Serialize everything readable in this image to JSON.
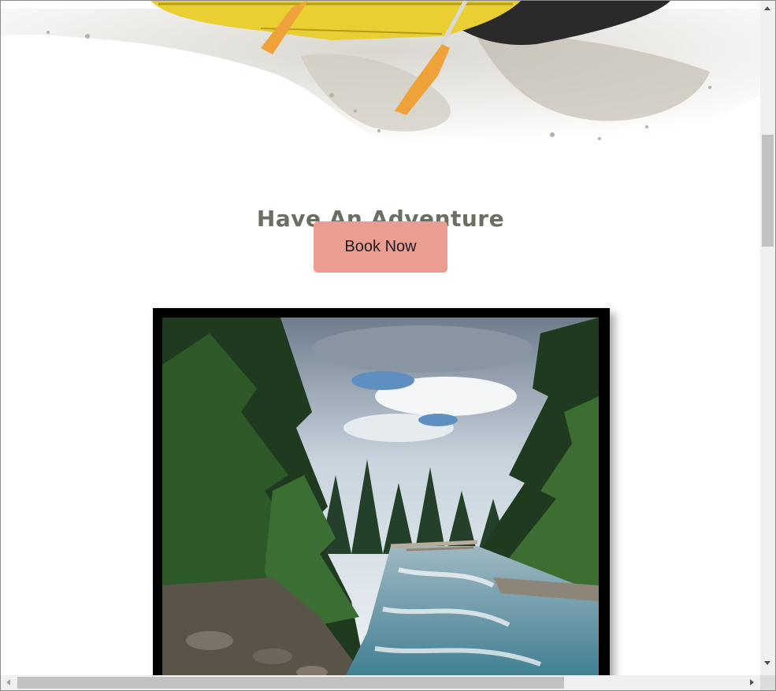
{
  "hero": {
    "image": "whitewater-rafting-splash"
  },
  "section": {
    "headline": "Have An Adventure",
    "button_label": "Book Now",
    "button_color": "#ec9d92",
    "headline_color": "#6c6e64"
  },
  "gallery": {
    "image": "forest-river-photo"
  },
  "icons": {
    "scroll_up": "arrow-up-icon",
    "scroll_down": "arrow-down-icon",
    "scroll_left": "arrow-left-icon",
    "scroll_right": "arrow-right-icon"
  }
}
